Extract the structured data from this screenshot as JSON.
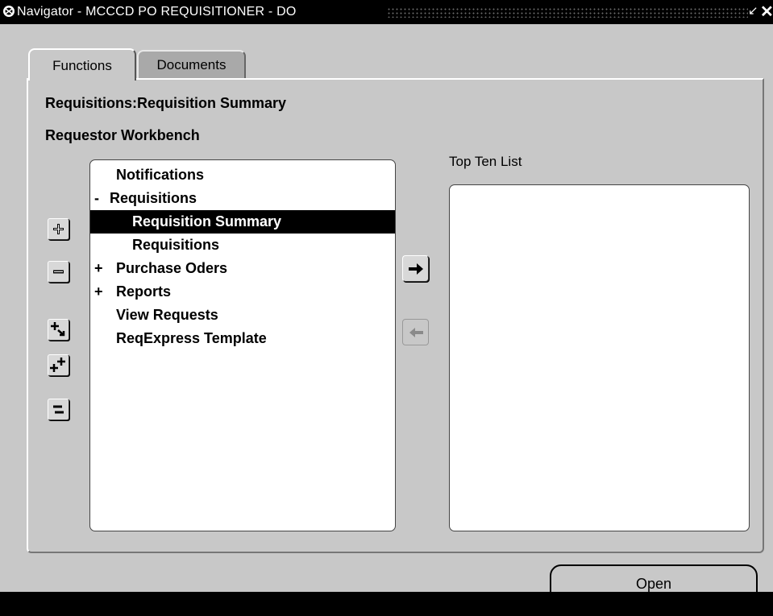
{
  "window": {
    "title": "Navigator - MCCCD PO REQUISITIONER - DO",
    "minimize_glyph": "↙",
    "close_glyph": "✕"
  },
  "tabs": [
    {
      "label": "Functions",
      "active": true
    },
    {
      "label": "Documents",
      "active": false
    }
  ],
  "breadcrumb": "Requisitions:Requisition Summary",
  "responsibility": "Requestor Workbench",
  "tree": [
    {
      "toggle": "",
      "label": "Notifications",
      "level": 1,
      "selected": false
    },
    {
      "toggle": "-",
      "label": "Requisitions",
      "level": 0,
      "selected": false
    },
    {
      "toggle": "",
      "label": "Requisition Summary",
      "level": 2,
      "selected": true
    },
    {
      "toggle": "",
      "label": "Requisitions",
      "level": 2,
      "selected": false
    },
    {
      "toggle": "+",
      "label": "Purchase Oders",
      "level": 0,
      "selected": false
    },
    {
      "toggle": "+",
      "label": "Reports",
      "level": 0,
      "selected": false
    },
    {
      "toggle": "",
      "label": "View Requests",
      "level": 1,
      "selected": false
    },
    {
      "toggle": "",
      "label": "ReqExpress Template",
      "level": 1,
      "selected": false
    }
  ],
  "side_buttons": [
    {
      "name": "expand-icon"
    },
    {
      "name": "collapse-icon"
    },
    {
      "name": "expand-branch-icon"
    },
    {
      "name": "expand-all-icon"
    },
    {
      "name": "collapse-all-icon"
    }
  ],
  "top_ten": {
    "label": "Top Ten List",
    "items": []
  },
  "buttons": {
    "open": "Open"
  },
  "colors": {
    "window_bg": "#c8c8c8",
    "selection_bg": "#000000",
    "selection_text": "#ffffff",
    "documents_tab_bg": "#a9a9a9"
  }
}
